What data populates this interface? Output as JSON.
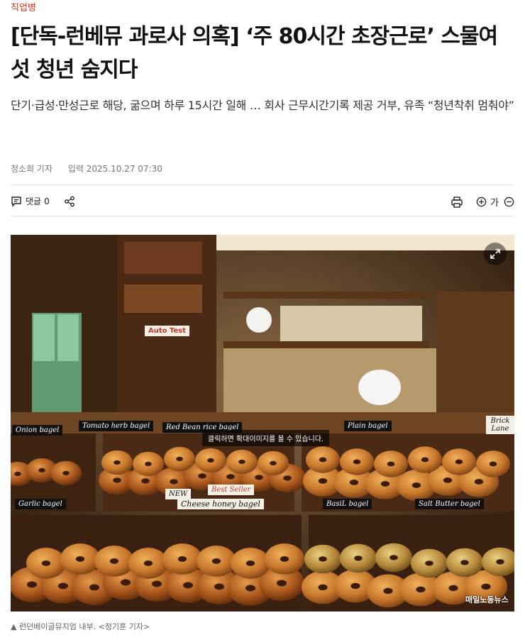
{
  "article": {
    "section": "직업병",
    "title": "[단독-런베뮤 과로사 의혹] ‘주 80시간 초장근로’ 스물여섯 청년 숨지다",
    "subtitle": "단기·급성·만성근로 해당, 굶으며 하루 15시간 일해 … 회사 근무시간기록 제공 거부, 유족 “청년착취 멈춰야”",
    "reporter": "정소희 기자",
    "date_label": "입력 2025.10.27 07:30"
  },
  "toolbar": {
    "comment_label": "댓글",
    "comment_count": "0",
    "font_label": "가"
  },
  "photo": {
    "tooltip": "클릭하면 확대이미지를 볼 수 있습니다.",
    "watermark": "매일노동뉴스",
    "caption": "▲ 런던베이글뮤지엄 내부. <정기훈 기자>",
    "signs": {
      "onion": "Onion bagel",
      "tomato": "Tomato herb bagel",
      "redbean": "Red Bean rice bagel",
      "plain": "Plain bagel",
      "garlic": "Garlic bagel",
      "cheese": "Cheese honey bagel",
      "basil": "BasiL bagel",
      "saltbutter": "Salt Butter bagel",
      "new": "NEW",
      "best": "Best Seller",
      "autotest": "Auto Test",
      "bricklane": "Brick Lane"
    }
  },
  "colors": {
    "section": "#d9331d",
    "bagel": "#c8782c",
    "wood": "#4a2a14"
  }
}
